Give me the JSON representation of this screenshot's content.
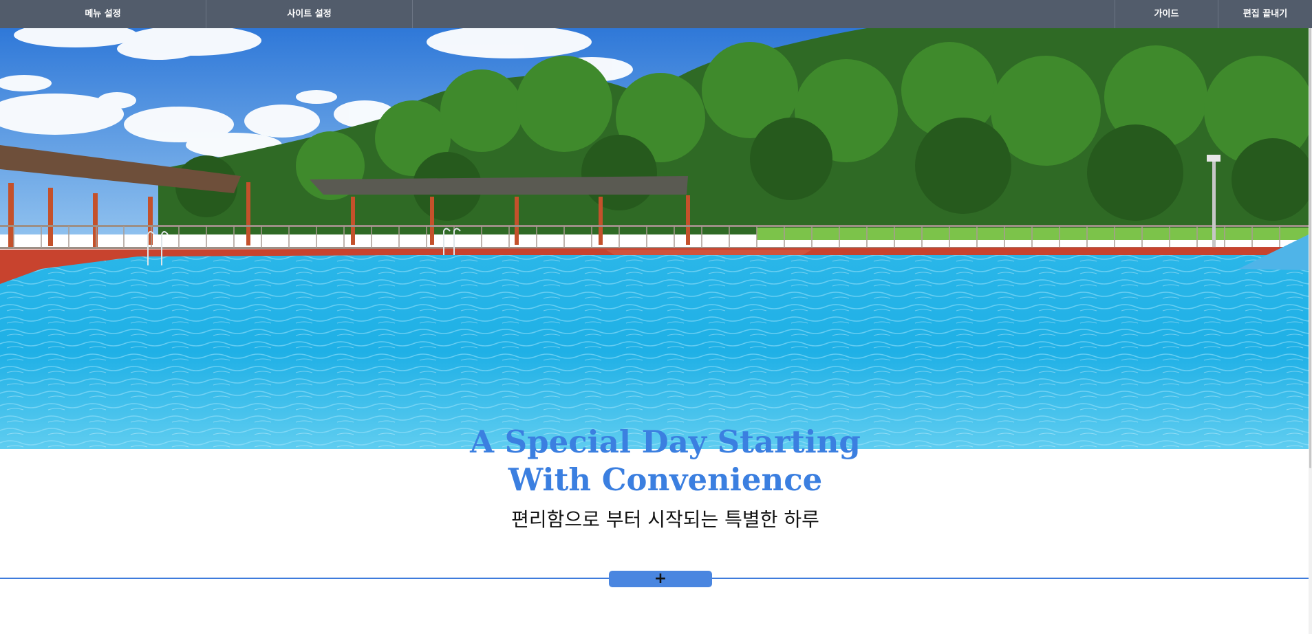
{
  "topbar": {
    "menu_settings": "메뉴 설정",
    "site_settings": "사이트 설정",
    "guide": "가이드",
    "exit_edit": "편집 끝내기",
    "background": "#525c6b"
  },
  "hero": {
    "image": "outdoor-swimming-pool-photo",
    "title_line1": "A Special Day Starting",
    "title_line2": "With Convenience",
    "subtitle": "편리함으로 부터 시작되는 특별한 하루",
    "title_color": "#3b7fe0"
  },
  "section_add": {
    "icon": "plus-icon",
    "label": "+",
    "color": "#4a86e0"
  }
}
